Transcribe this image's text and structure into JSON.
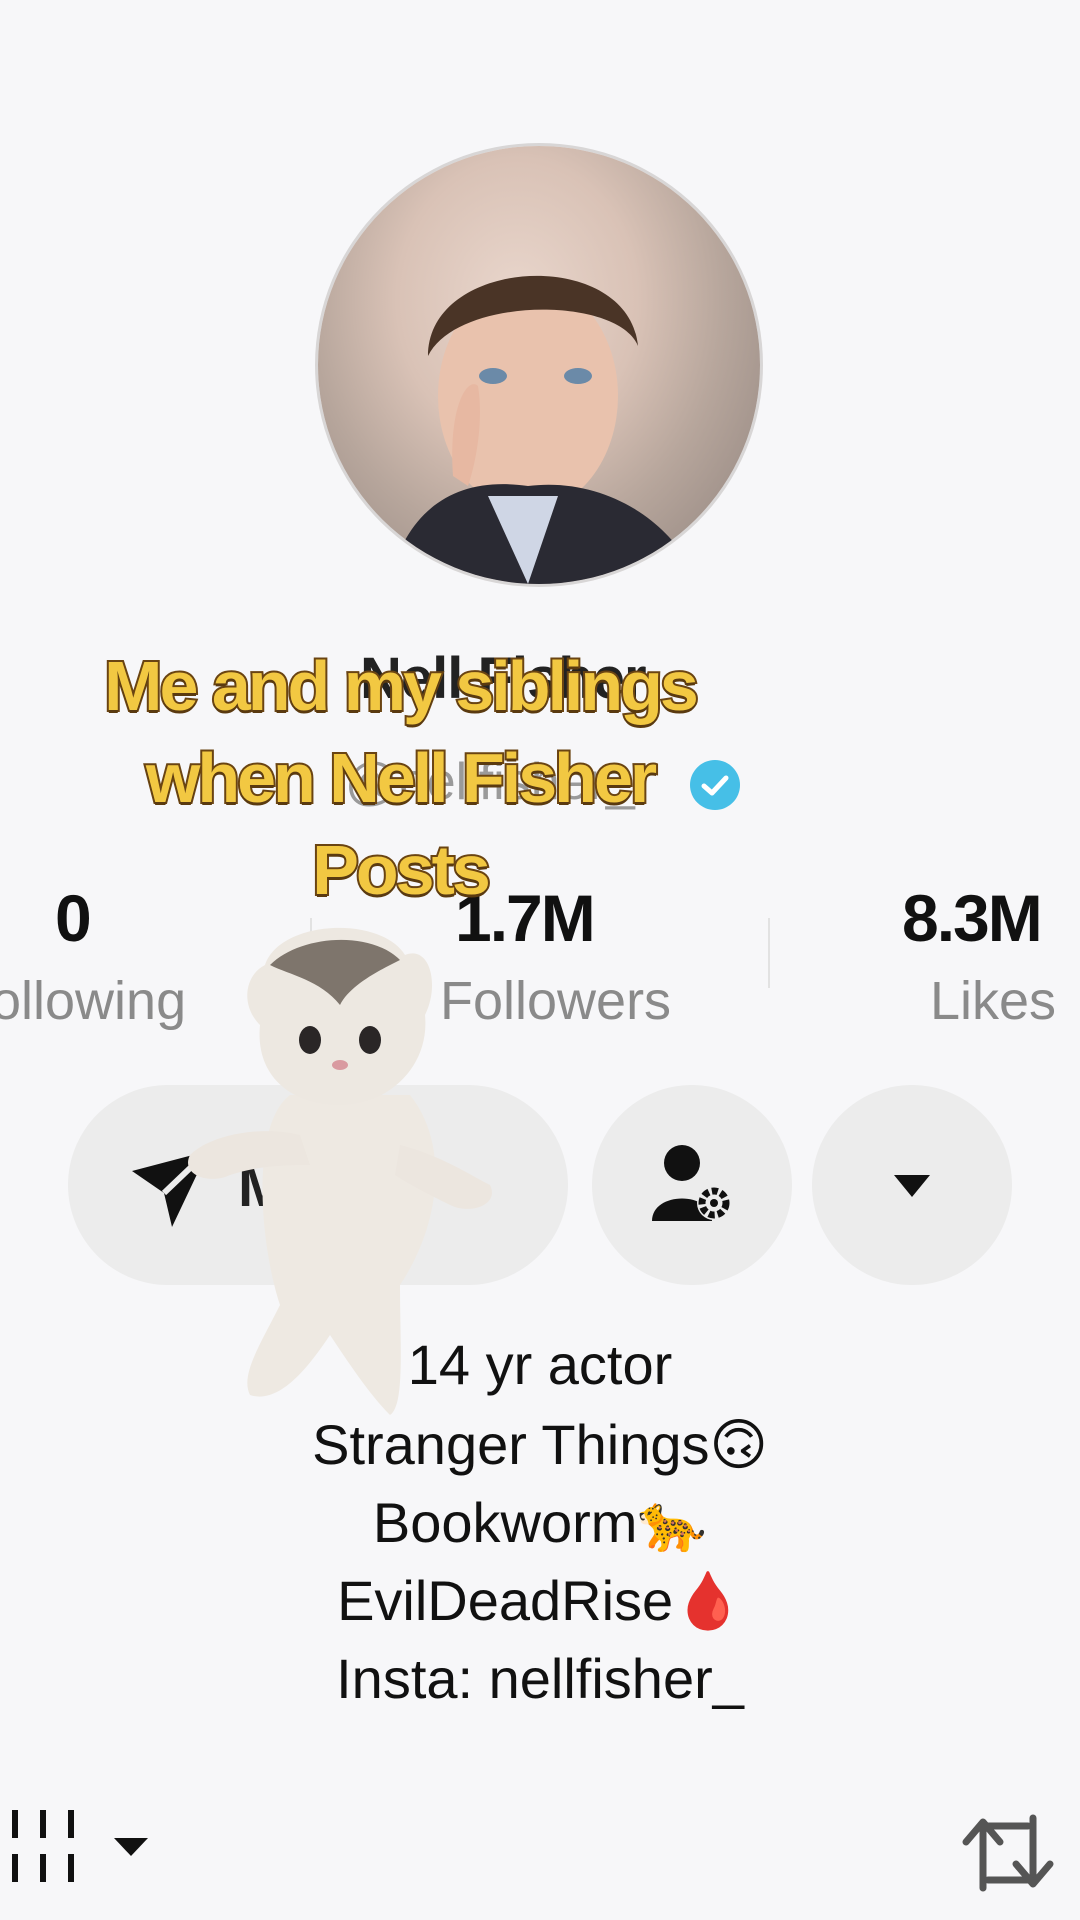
{
  "caption": {
    "lines": [
      "Me and my siblings",
      "when Nell Fisher",
      "Posts"
    ]
  },
  "profile": {
    "display_name": "Nell Fisher",
    "username": "@nellfisher_",
    "verified": true
  },
  "stats": {
    "following_count": "0",
    "following_label": "Following",
    "followers_count": "1.7M",
    "followers_label": "Followers",
    "likes_count": "8.3M",
    "likes_label": "Likes"
  },
  "buttons": {
    "message_label": "M",
    "add_friend_icon": "person-gear-icon",
    "dropdown_icon": "caret-down-icon"
  },
  "bio": {
    "line1": "14 yr actor",
    "line2_text": "Stranger Things",
    "line2_emoji": "🙃",
    "line3_text": "Bookworm",
    "line3_emoji": "🐆",
    "line4_text": "EvilDeadRise",
    "line4_emoji": "🩸",
    "line5": "Insta: nellfisher_"
  },
  "bottom_bar": {
    "left_icon": "grid-filter-icon",
    "right_icon": "repost-icon"
  },
  "colors": {
    "caption_fill": "#f2c842",
    "caption_stroke": "#6a4412",
    "verified": "#46bfe7",
    "background": "#f7f7f9"
  }
}
